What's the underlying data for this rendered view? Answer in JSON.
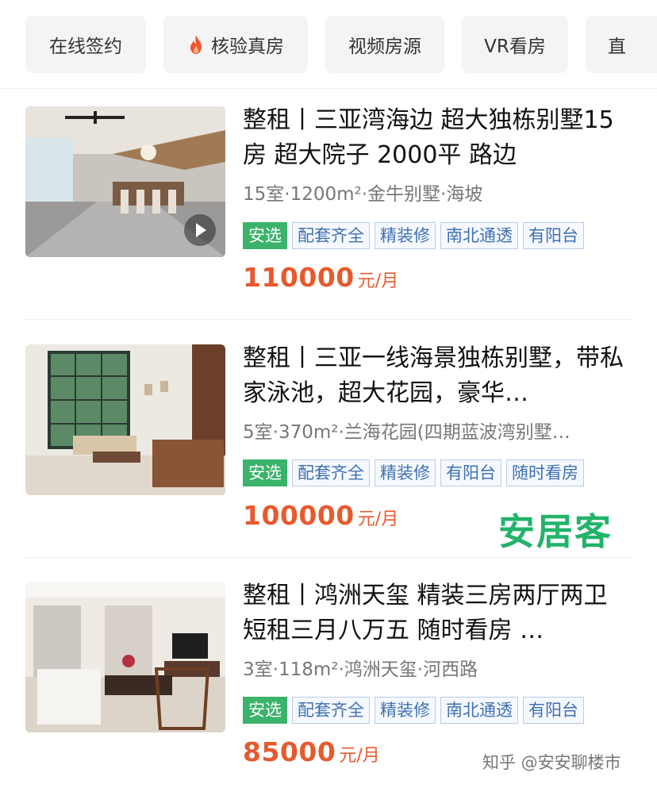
{
  "filters": [
    {
      "label": "在线签约",
      "icon": null
    },
    {
      "label": "核验真房",
      "icon": "fire-icon"
    },
    {
      "label": "视频房源",
      "icon": null
    },
    {
      "label": "VR看房",
      "icon": null
    },
    {
      "label": "直",
      "icon": null
    }
  ],
  "listings": [
    {
      "title": "整租丨三亚湾海边 超大独栋别墅15房 超大院子 2000平 路边",
      "meta": "15室·1200m²·金牛别墅·海坡",
      "tags": [
        "安选",
        "配套齐全",
        "精装修",
        "南北通透",
        "有阳台"
      ],
      "price": "110000",
      "unit": "元/月",
      "has_video": true
    },
    {
      "title": "整租丨三亚一线海景独栋别墅，带私家泳池，超大花园，豪华…",
      "meta": "5室·370m²·兰海花园(四期蓝波湾别墅…",
      "tags": [
        "安选",
        "配套齐全",
        "精装修",
        "有阳台",
        "随时看房"
      ],
      "price": "100000",
      "unit": "元/月",
      "has_video": false
    },
    {
      "title": "整租丨鸿洲天玺 精装三房两厅两卫 短租三月八万五 随时看房 …",
      "meta": "3室·118m²·鸿洲天玺·河西路",
      "tags": [
        "安选",
        "配套齐全",
        "精装修",
        "南北通透",
        "有阳台"
      ],
      "price": "85000",
      "unit": "元/月",
      "has_video": false
    }
  ],
  "brand_watermark": "安居客",
  "source_watermark": "知乎 @安安聊楼市",
  "colors": {
    "price": "#e65a2e",
    "tag_green": "#3bb36b",
    "tag_blue": "#3e70b2",
    "brand": "#22b36b"
  }
}
